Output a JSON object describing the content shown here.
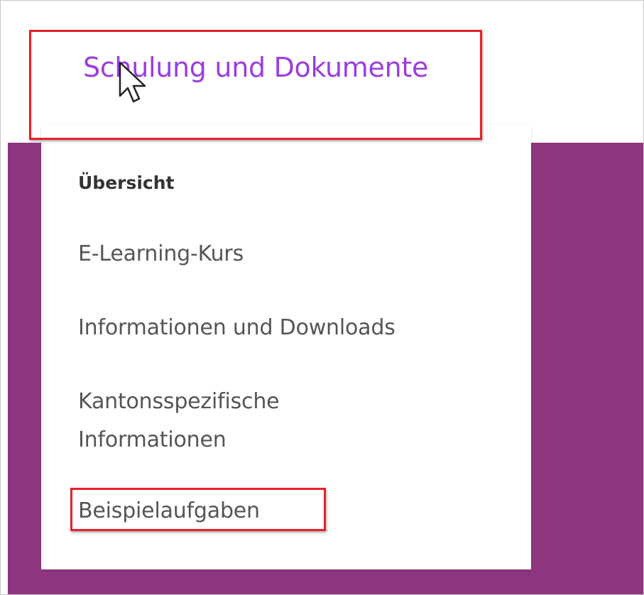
{
  "nav": {
    "tab_label": "Schulung und Dokumente"
  },
  "dropdown": {
    "items": [
      {
        "label": "Übersicht"
      },
      {
        "label": "E-Learning-Kurs"
      },
      {
        "label": "Informationen und Downloads"
      },
      {
        "label": "Kantonsspezifische"
      },
      {
        "label": "Informationen"
      },
      {
        "label": "Beispielaufgaben"
      }
    ]
  },
  "colors": {
    "accent_purple_text": "#9b3ddf",
    "band_purple": "#8e3580",
    "highlight_red": "#e8202a"
  },
  "icons": {
    "cursor": "mouse-pointer-icon"
  }
}
